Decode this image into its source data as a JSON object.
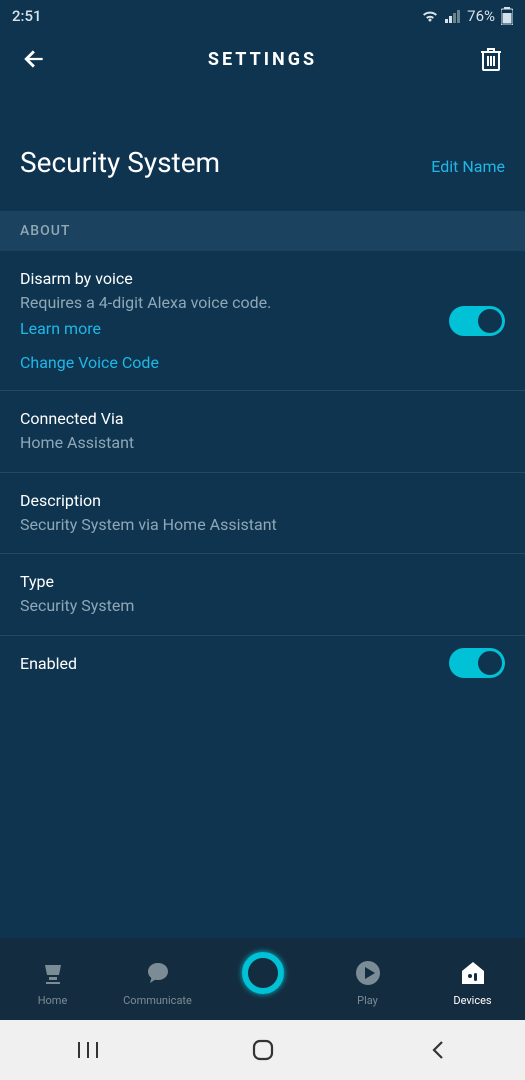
{
  "status": {
    "time": "2:51",
    "battery": "76%"
  },
  "header": {
    "title": "SETTINGS"
  },
  "page": {
    "title": "Security System",
    "edit_label": "Edit Name"
  },
  "section": {
    "about": "ABOUT"
  },
  "disarm": {
    "label": "Disarm by voice",
    "sub": "Requires a 4-digit Alexa voice code.",
    "learn_more": "Learn more",
    "change_code": "Change Voice Code",
    "enabled": true
  },
  "connected": {
    "label": "Connected Via",
    "value": "Home Assistant"
  },
  "description": {
    "label": "Description",
    "value": "Security System via Home Assistant"
  },
  "type": {
    "label": "Type",
    "value": "Security System"
  },
  "enabled_row": {
    "label": "Enabled",
    "enabled": true
  },
  "nav": {
    "home": "Home",
    "communicate": "Communicate",
    "play": "Play",
    "devices": "Devices"
  }
}
